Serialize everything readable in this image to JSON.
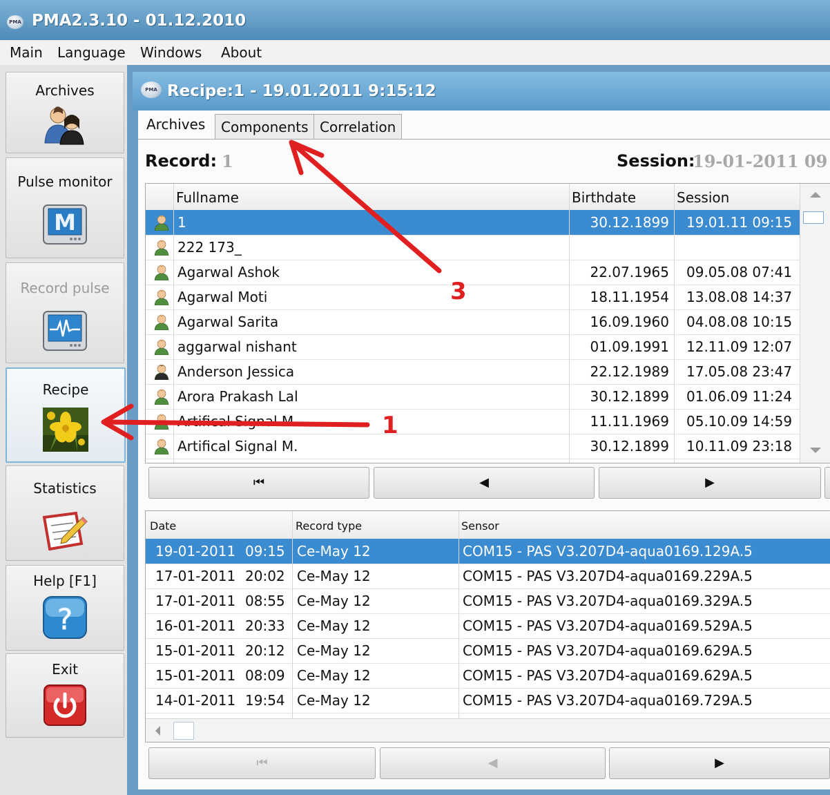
{
  "window": {
    "title": "PMA2.3.10 - 01.12.2010",
    "logo_text": "PMA"
  },
  "menu": [
    "Main",
    "Language",
    "Windows",
    "About"
  ],
  "sidebar": {
    "items": [
      {
        "label": "Archives",
        "icon": "users-icon"
      },
      {
        "label": "Pulse monitor",
        "icon": "monitor-m-icon"
      },
      {
        "label": "Record pulse",
        "icon": "pulse-wave-icon",
        "disabled": true
      },
      {
        "label": "Recipe",
        "icon": "flower-image-icon",
        "active": true
      },
      {
        "label": "Statistics",
        "icon": "notepad-pencil-icon"
      },
      {
        "label": "Help [F1]",
        "icon": "help-question-icon"
      },
      {
        "label": "Exit",
        "icon": "power-icon"
      }
    ]
  },
  "inner_window": {
    "title": "Recipe:1 - 19.01.2011 9:15:12",
    "logo_text": "PMA"
  },
  "tabs": [
    {
      "label": "Archives",
      "active": true
    },
    {
      "label": "Components"
    },
    {
      "label": "Correlation"
    }
  ],
  "record": {
    "label": "Record:",
    "value": "1"
  },
  "session": {
    "label": "Session:",
    "value": "19-01-2011  09"
  },
  "people_table": {
    "columns": [
      "Fullname",
      "Birthdate",
      "Session"
    ],
    "rows": [
      {
        "name": "1",
        "birthdate": "30.12.1899",
        "session": "19.01.11 09:15",
        "selected": true
      },
      {
        "name": "222 173_",
        "birthdate": "",
        "session": ""
      },
      {
        "name": "Agarwal Ashok",
        "birthdate": "22.07.1965",
        "session": "09.05.08 07:41"
      },
      {
        "name": "Agarwal Moti",
        "birthdate": "18.11.1954",
        "session": "13.08.08 14:37"
      },
      {
        "name": "Agarwal Sarita",
        "birthdate": "16.09.1960",
        "session": "04.08.08 10:15"
      },
      {
        "name": "aggarwal nishant",
        "birthdate": "01.09.1991",
        "session": "12.11.09 12:07"
      },
      {
        "name": "Anderson Jessica",
        "birthdate": "22.12.1989",
        "session": "17.05.08 23:47",
        "female": true
      },
      {
        "name": "Arora Prakash Lal",
        "birthdate": "30.12.1899",
        "session": "01.06.09 11:24"
      },
      {
        "name": "Artifical Signal M.",
        "birthdate": "11.11.1969",
        "session": "05.10.09 14:59"
      },
      {
        "name": "Artifical Signal M.",
        "birthdate": "30.12.1899",
        "session": "10.11.09 23:18"
      }
    ]
  },
  "nav1": {
    "first": "⏮",
    "prev": "◀",
    "next": "▶"
  },
  "records_table": {
    "columns": [
      "Date",
      "Record type",
      "Sensor"
    ],
    "rows": [
      {
        "date": "19-01-2011",
        "time": "09:15",
        "type": "Ce-May 12",
        "sensor": "COM15 - PAS V3.207D4-aqua0169.129A.5",
        "selected": true
      },
      {
        "date": "17-01-2011",
        "time": "20:02",
        "type": "Ce-May 12",
        "sensor": "COM15 - PAS V3.207D4-aqua0169.229A.5"
      },
      {
        "date": "17-01-2011",
        "time": "08:55",
        "type": "Ce-May 12",
        "sensor": "COM15 - PAS V3.207D4-aqua0169.329A.5"
      },
      {
        "date": "16-01-2011",
        "time": "20:33",
        "type": "Ce-May 12",
        "sensor": "COM15 - PAS V3.207D4-aqua0169.529A.5"
      },
      {
        "date": "15-01-2011",
        "time": "20:12",
        "type": "Ce-May 12",
        "sensor": "COM15 - PAS V3.207D4-aqua0169.629A.5"
      },
      {
        "date": "15-01-2011",
        "time": "08:09",
        "type": "Ce-May 12",
        "sensor": "COM15 - PAS V3.207D4-aqua0169.629A.5"
      },
      {
        "date": "14-01-2011",
        "time": "19:54",
        "type": "Ce-May 12",
        "sensor": "COM15 - PAS V3.207D4-aqua0169.729A.5"
      }
    ]
  },
  "nav2": {
    "first": "⏮",
    "prev": "◀",
    "next": "▶"
  },
  "annotations": {
    "arrow1": "1",
    "arrow3": "3",
    "color": "#e02020"
  },
  "colors": {
    "selection": "#3b8bd1",
    "title_bar": "#5a9acb"
  }
}
